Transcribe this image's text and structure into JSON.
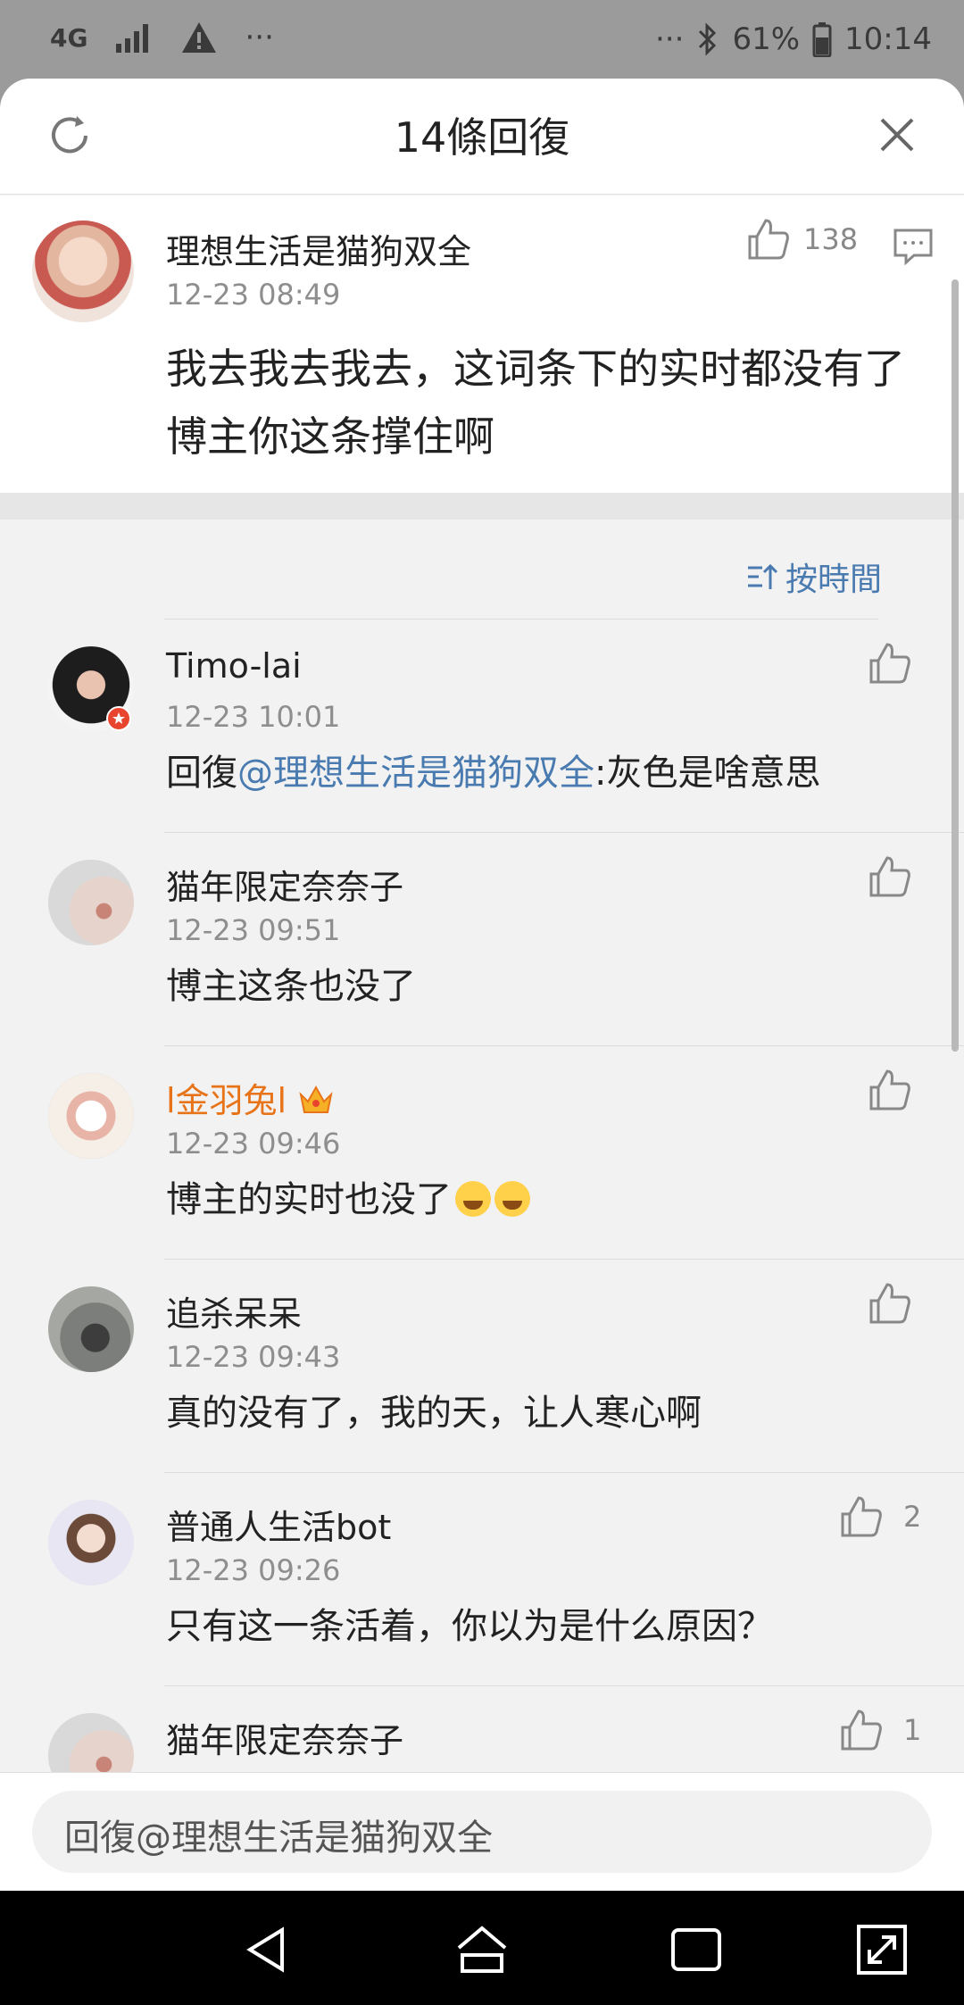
{
  "status_bar": {
    "network": "4G",
    "more_left": "···",
    "more_right": "···",
    "battery": "61%",
    "time": "10:14"
  },
  "header": {
    "title": "14條回復"
  },
  "original_comment": {
    "user": "理想生活是猫狗双全",
    "time": "12-23 08:49",
    "likes": "138",
    "text": "我去我去我去，这词条下的实时都没有了博主你这条撑住啊"
  },
  "sort": {
    "label": "按時間"
  },
  "replies": [
    {
      "user": "Timo-lai",
      "time": "12-23 10:01",
      "text_prefix": "回復",
      "mention": "@理想生活是猫狗双全",
      "text": ":灰色是啥意思",
      "likes": ""
    },
    {
      "user": "猫年限定奈奈子",
      "time": "12-23 09:51",
      "text": "博主这条也没了",
      "likes": ""
    },
    {
      "user": "l金羽兔l",
      "time": "12-23 09:46",
      "text": "博主的实时也没了",
      "likes": "",
      "name_color": "#e8741a"
    },
    {
      "user": "追杀呆呆",
      "time": "12-23 09:43",
      "text": "真的没有了，我的天，让人寒心啊",
      "likes": ""
    },
    {
      "user": "普通人生活bot",
      "time": "12-23 09:26",
      "text": "只有这一条活着，你以为是什么原因？",
      "likes": "2"
    },
    {
      "user": "猫年限定奈奈子",
      "likes": "1"
    }
  ],
  "footer": {
    "placeholder": "回復@理想生活是猫狗双全"
  },
  "colors": {
    "link": "#4a7bb0",
    "vip_name": "#e8741a"
  }
}
